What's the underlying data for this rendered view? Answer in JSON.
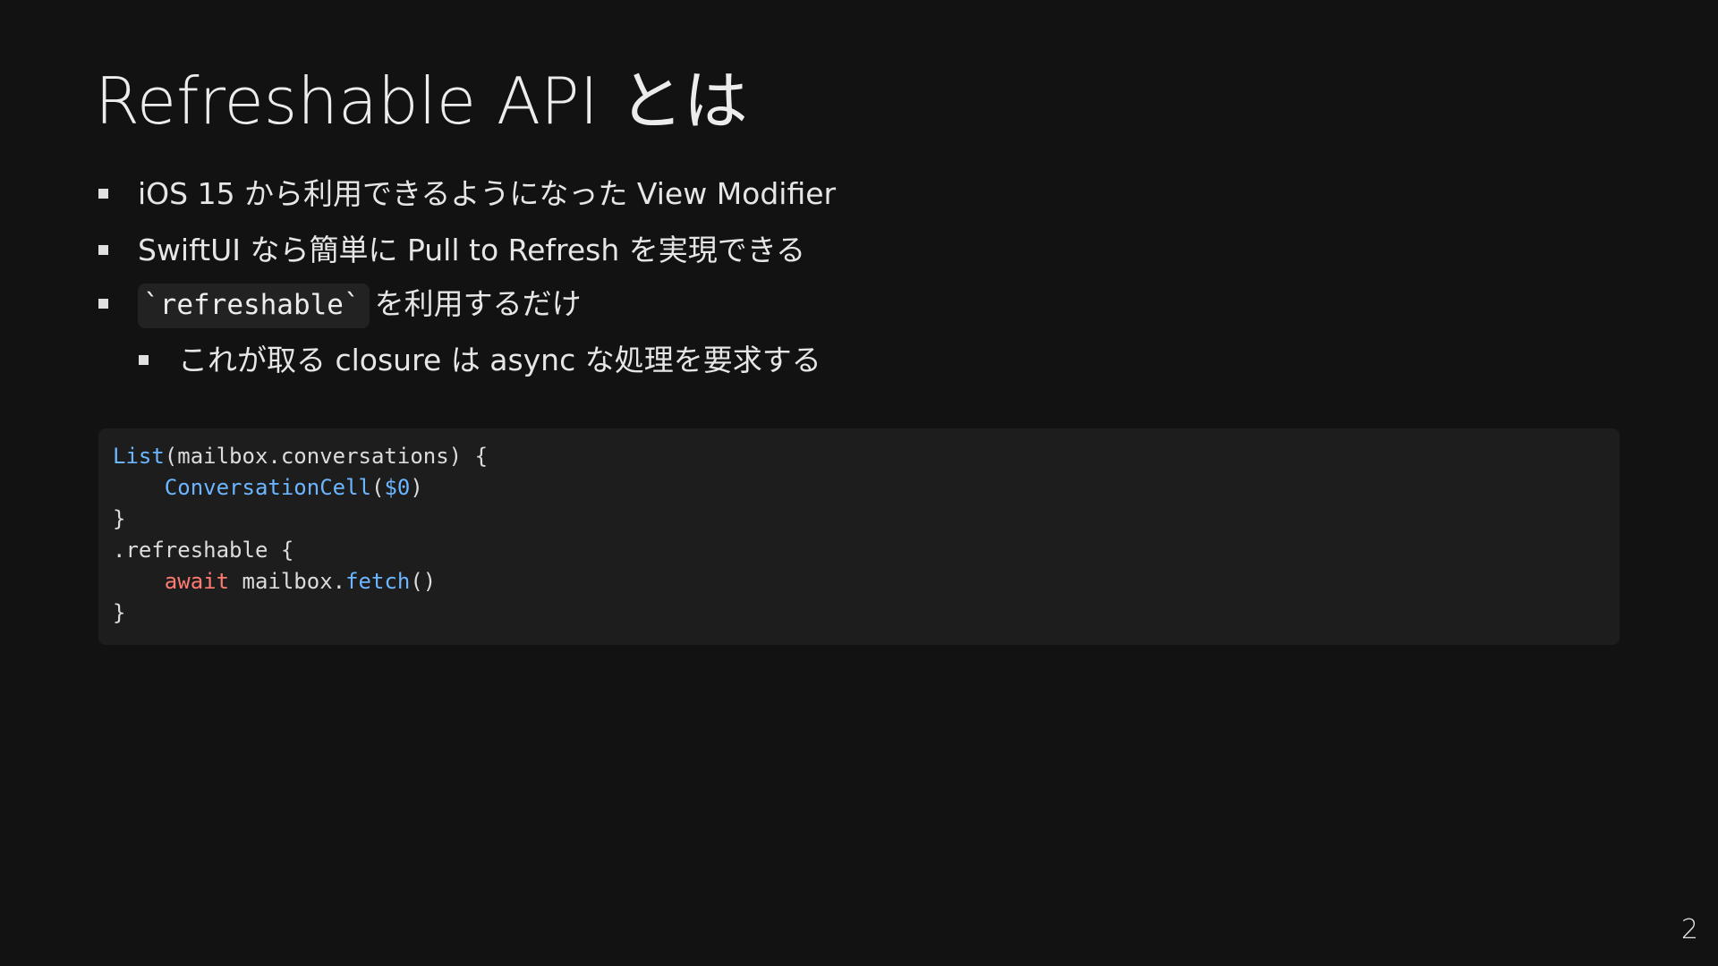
{
  "slide": {
    "title": "Refreshable API とは",
    "page_number": "2"
  },
  "bullets": [
    {
      "level": 1,
      "text": "iOS 15 から利用できるようになった View Modifier"
    },
    {
      "level": 1,
      "text": "SwiftUI なら簡単に Pull to Refresh を実現できる"
    },
    {
      "level": 1,
      "code": "`refreshable`",
      "text": "を利用するだけ"
    },
    {
      "level": 2,
      "text": "これが取る closure は async な処理を要求する"
    }
  ],
  "code": {
    "line1": {
      "type": "List",
      "rest": "(mailbox.conversations) {"
    },
    "line2": {
      "indent": "    ",
      "type": "ConversationCell",
      "paren_open": "(",
      "arg": "$0",
      "paren_close": ")"
    },
    "line3": {
      "text": "}"
    },
    "line4": {
      "text": ".refreshable {"
    },
    "line5": {
      "indent": "    ",
      "keyword": "await",
      "mid": " mailbox.",
      "fn": "fetch",
      "rest": "()"
    },
    "line6": {
      "text": "}"
    }
  },
  "colors": {
    "background": "#121212",
    "code_background": "#1d1d1d",
    "type_color": "#6cb6ff",
    "keyword_color": "#ff7b72"
  }
}
